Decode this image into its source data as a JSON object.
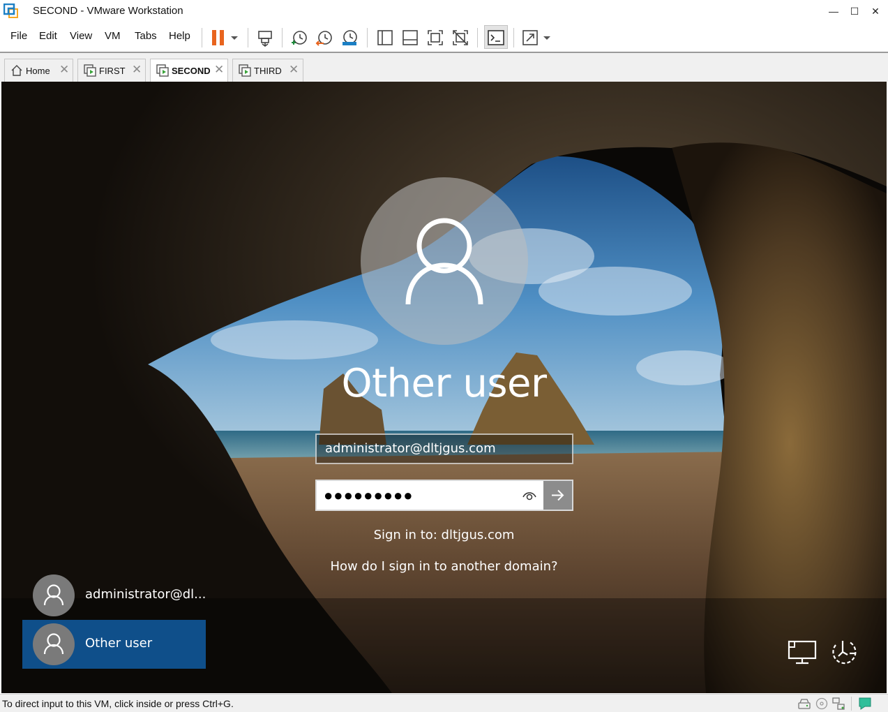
{
  "window": {
    "title": "SECOND - VMware Workstation",
    "controls": {
      "minimize": "—",
      "maximize": "☐",
      "close": "✕"
    }
  },
  "menu": {
    "items": [
      "File",
      "Edit",
      "View",
      "VM",
      "Tabs",
      "Help"
    ]
  },
  "toolbar": {
    "icons": [
      "pause-icon",
      "dropdown-icon",
      "send-ctrl-alt-del-icon",
      "snapshot-take-icon",
      "snapshot-revert-icon",
      "snapshot-manager-icon",
      "library-view-icon",
      "thumbnail-bar-icon",
      "fullscreen-icon",
      "unity-icon",
      "console-view-icon",
      "stretch-icon",
      "dropdown-icon"
    ],
    "accent_color": "#e8641e"
  },
  "tabs": [
    {
      "label": "Home",
      "icon": "home-icon",
      "active": false
    },
    {
      "label": "FIRST",
      "icon": "vm-icon",
      "active": false
    },
    {
      "label": "SECOND",
      "icon": "vm-icon",
      "active": true
    },
    {
      "label": "THIRD",
      "icon": "vm-icon",
      "active": false
    }
  ],
  "tab_close_glyph": "✕",
  "login": {
    "user_display_name": "Other user",
    "username_value": "administrator@dltjgus.com",
    "password_mask": "●●●●●●●●●",
    "sign_in_to": "Sign in to: dltjgus.com",
    "other_domain_link": "How do I sign in to another domain?",
    "user_tiles": [
      {
        "name": "administrator@dl...",
        "selected": false
      },
      {
        "name": "Other user",
        "selected": true
      }
    ],
    "selected_color": "#0f4f8a"
  },
  "status": {
    "message": "To direct input to this VM, click inside or press Ctrl+G."
  }
}
